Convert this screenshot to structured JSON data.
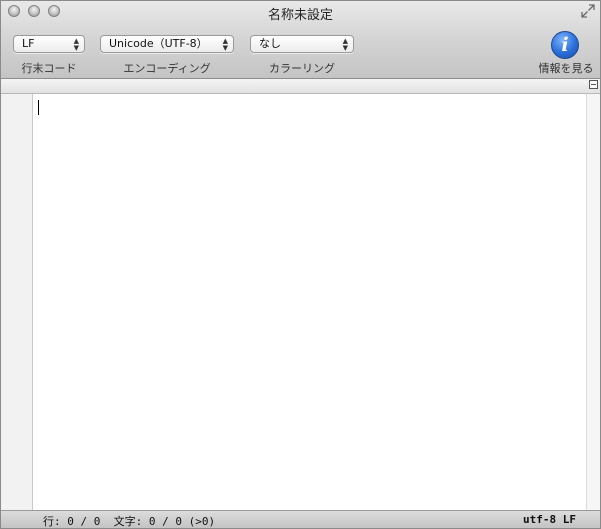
{
  "window": {
    "title": "名称未設定"
  },
  "toolbar": {
    "line_ending": {
      "selected": "LF",
      "label": "行末コード"
    },
    "encoding": {
      "selected": "Unicode（UTF-8）",
      "label": "エンコーディング"
    },
    "coloring": {
      "selected": "なし",
      "label": "カラーリング"
    },
    "info": {
      "icon": "info-icon",
      "glyph": "i",
      "label": "情報を見る"
    }
  },
  "editor": {
    "content": ""
  },
  "status": {
    "left": "行: 0 / 0  文字: 0 / 0 (>0)",
    "right": "utf-8 LF"
  },
  "colors": {
    "info_blue": "#2a6ed8"
  }
}
